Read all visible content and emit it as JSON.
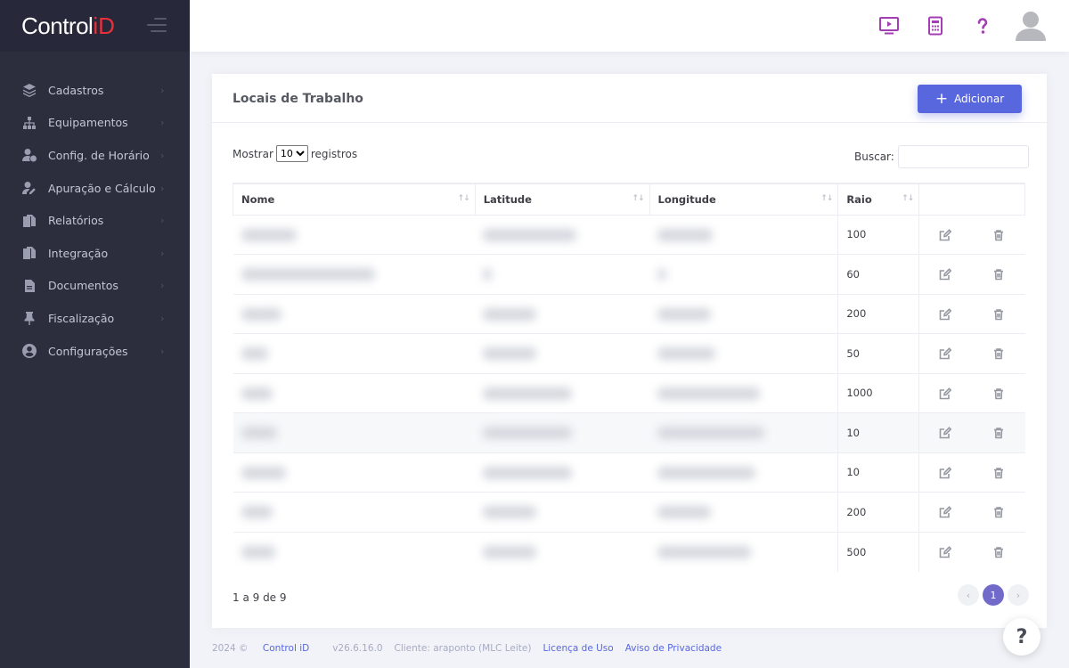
{
  "brand": {
    "name": "Control",
    "accent": "iD"
  },
  "sidebar": {
    "items": [
      {
        "label": "Cadastros",
        "icon": "layers-icon"
      },
      {
        "label": "Equipamentos",
        "icon": "sitemap-icon"
      },
      {
        "label": "Config. de Horário",
        "icon": "user-clock-icon"
      },
      {
        "label": "Apuração e Cálculo",
        "icon": "user-edit-icon"
      },
      {
        "label": "Relatórios",
        "icon": "copy-icon"
      },
      {
        "label": "Integração",
        "icon": "copy-icon"
      },
      {
        "label": "Documentos",
        "icon": "file-icon"
      },
      {
        "label": "Fiscalização",
        "icon": "thumbtack-icon"
      },
      {
        "label": "Configurações",
        "icon": "user-circle-icon"
      }
    ]
  },
  "header": {
    "icons": [
      "monitor-play-icon",
      "calculator-icon",
      "question-icon",
      "user-avatar-icon"
    ],
    "accent_color": "#a43eb5"
  },
  "card": {
    "title": "Locais de Trabalho",
    "add_label": "Adicionar",
    "length": {
      "prefix": "Mostrar",
      "value": "10",
      "options": [
        "10"
      ],
      "suffix": "registros"
    },
    "search": {
      "label": "Buscar:",
      "value": ""
    },
    "columns": [
      "Nome",
      "Latitude",
      "Longitude",
      "Raio"
    ],
    "rows": [
      {
        "raio": "100"
      },
      {
        "raio": "60"
      },
      {
        "raio": "200"
      },
      {
        "raio": "50"
      },
      {
        "raio": "1000"
      },
      {
        "raio": "10"
      },
      {
        "raio": "10"
      },
      {
        "raio": "200"
      },
      {
        "raio": "500"
      }
    ],
    "info": "1 a 9 de 9",
    "pager": {
      "prev": "‹",
      "current": "1",
      "next": "›"
    }
  },
  "footer": {
    "copyright": "2024 ©",
    "brand_link": "Control iD",
    "version": "v26.6.16.0",
    "client": "Cliente: araponto (MLC Leite)",
    "license": "Licença de Uso",
    "privacy": "Aviso de Privacidade"
  },
  "help_fab": "?",
  "colors": {
    "primary": "#5867dd",
    "brand_red": "#e8303a",
    "sidebar_bg": "#2c2e3e",
    "pager_active": "#716aca"
  }
}
